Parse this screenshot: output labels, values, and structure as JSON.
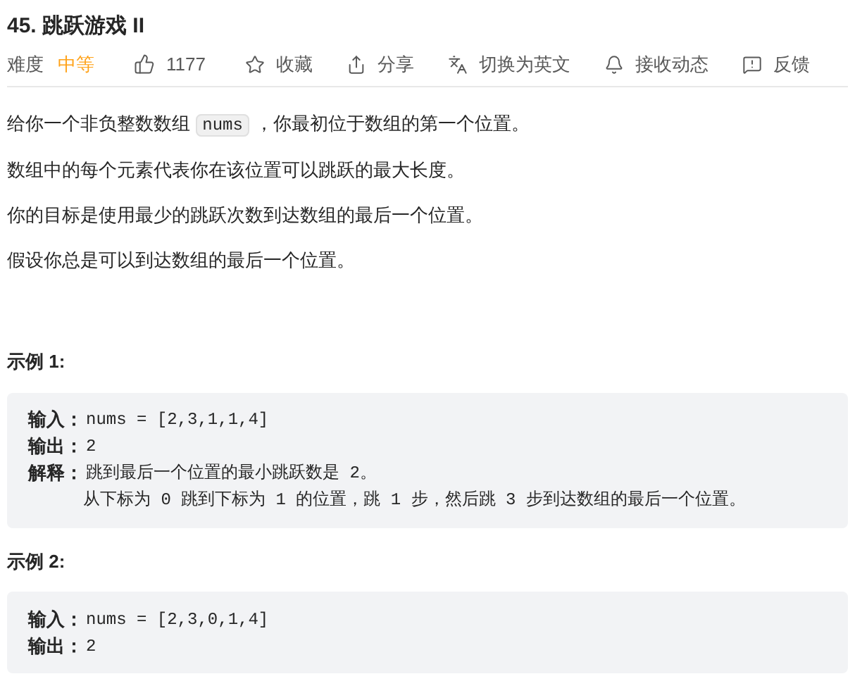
{
  "title": "45. 跳跃游戏 II",
  "meta": {
    "difficulty_label": "难度",
    "difficulty": "中等",
    "likes": "1177",
    "actions": [
      {
        "kind": "star",
        "label": "收藏"
      },
      {
        "kind": "share",
        "label": "分享"
      },
      {
        "kind": "translate",
        "label": "切换为英文"
      },
      {
        "kind": "bell",
        "label": "接收动态"
      },
      {
        "kind": "feedback",
        "label": "反馈"
      }
    ]
  },
  "description": [
    [
      {
        "kind": "text",
        "text": "给你一个非负整数数组 "
      },
      {
        "kind": "code",
        "text": "nums"
      },
      {
        "kind": "text",
        "text": " ，你最初位于数组的第一个位置。"
      }
    ],
    [
      {
        "kind": "text",
        "text": "数组中的每个元素代表你在该位置可以跳跃的最大长度。"
      }
    ],
    [
      {
        "kind": "text",
        "text": "你的目标是使用最少的跳跃次数到达数组的最后一个位置。"
      }
    ],
    [
      {
        "kind": "text",
        "text": "假设你总是可以到达数组的最后一个位置。"
      }
    ]
  ],
  "examples": [
    {
      "heading": "示例 1:",
      "lines": [
        {
          "label": "输入：",
          "value": "nums = [2,3,1,1,4]"
        },
        {
          "label": "输出：",
          "value": "2"
        },
        {
          "label": "解释：",
          "value": "跳到最后一个位置的最小跳跃数是 2。"
        },
        {
          "value": "从下标为 0 跳到下标为 1 的位置，跳 1 步，然后跳 3 步到达数组的最后一个位置。"
        }
      ]
    },
    {
      "heading": "示例 2:",
      "lines": [
        {
          "label": "输入：",
          "value": "nums = [2,3,0,1,4]"
        },
        {
          "label": "输出：",
          "value": "2"
        }
      ]
    }
  ]
}
